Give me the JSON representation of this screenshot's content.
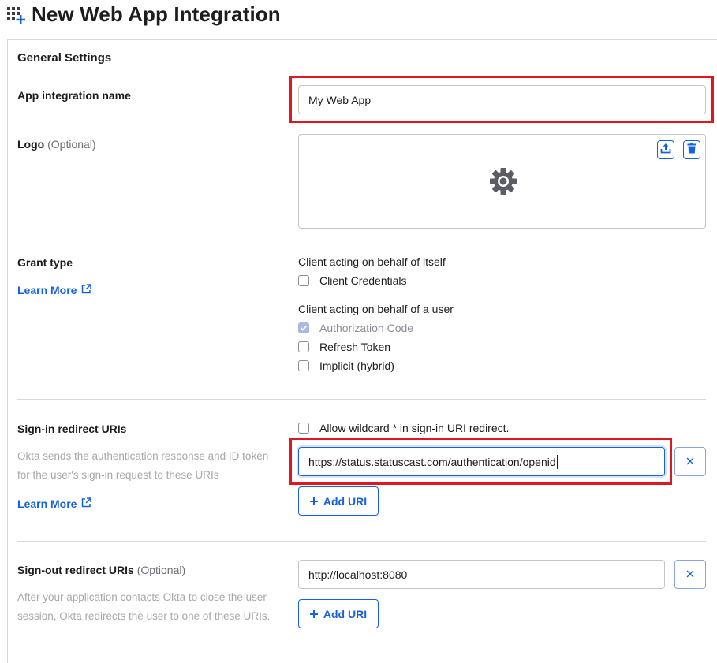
{
  "header": {
    "title": "New Web App Integration",
    "icon": "grid-add-icon"
  },
  "general": {
    "section_title": "General Settings",
    "app_name": {
      "label": "App integration name",
      "value": "My Web App"
    },
    "logo": {
      "label": "Logo",
      "optional": "(Optional)",
      "icons": [
        "upload-icon",
        "trash-icon",
        "gear-icon"
      ]
    }
  },
  "grant": {
    "label": "Grant type",
    "learn_more": "Learn More",
    "self_heading": "Client acting on behalf of itself",
    "client_credentials": {
      "label": "Client Credentials",
      "checked": false
    },
    "user_heading": "Client acting on behalf of a user",
    "authorization_code": {
      "label": "Authorization Code",
      "checked": true
    },
    "refresh_token": {
      "label": "Refresh Token",
      "checked": false
    },
    "implicit": {
      "label": "Implicit (hybrid)",
      "checked": false
    }
  },
  "signin": {
    "label": "Sign-in redirect URIs",
    "help": "Okta sends the authentication response and ID token for the user's sign-in request to these URIs",
    "learn_more": "Learn More",
    "wildcard": {
      "label": "Allow wildcard * in sign-in URI redirect.",
      "checked": false
    },
    "uri": "https://status.statuscast.com/authentication/openid",
    "add_label": "Add URI"
  },
  "signout": {
    "label": "Sign-out redirect URIs",
    "optional": "(Optional)",
    "help": "After your application contacts Okta to close the user session, Okta redirects the user to one of these URIs.",
    "uri": "http://localhost:8080",
    "add_label": "Add URI"
  },
  "colors": {
    "accent": "#1662dd",
    "highlight": "#e0171f",
    "muted": "#a7a7ad"
  }
}
